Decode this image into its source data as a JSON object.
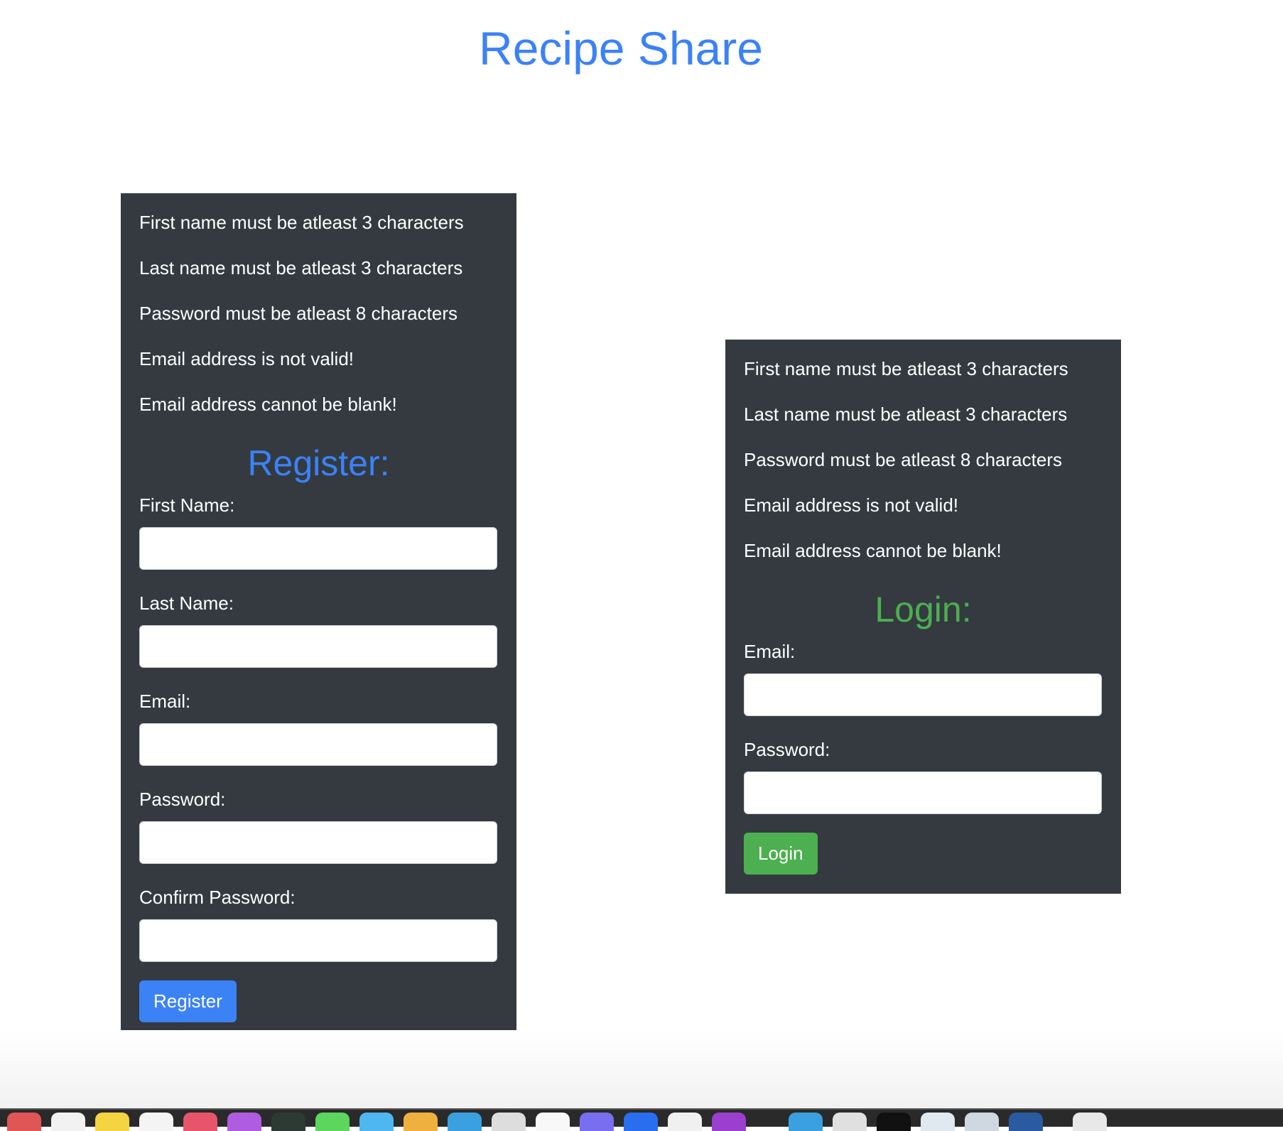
{
  "app": {
    "title": "Recipe Share"
  },
  "register": {
    "errors": [
      "First name must be atleast 3 characters",
      "Last name must be atleast 3 characters",
      "Password must be atleast 8 characters",
      "Email address is not valid!",
      "Email address cannot be blank!"
    ],
    "heading": "Register:",
    "first_name_label": "First Name:",
    "first_name_value": "",
    "last_name_label": "Last Name:",
    "last_name_value": "",
    "email_label": "Email:",
    "email_value": "",
    "password_label": "Password:",
    "password_value": "",
    "confirm_label": "Confirm Password:",
    "confirm_value": "",
    "button_label": "Register"
  },
  "login": {
    "errors": [
      "First name must be atleast 3 characters",
      "Last name must be atleast 3 characters",
      "Password must be atleast 8 characters",
      "Email address is not valid!",
      "Email address cannot be blank!"
    ],
    "heading": "Login:",
    "email_label": "Email:",
    "email_value": "",
    "password_label": "Password:",
    "password_value": "",
    "button_label": "Login"
  },
  "colors": {
    "accent_blue": "#3b82f6",
    "accent_green": "#4caf50",
    "panel_bg": "#343a40"
  }
}
